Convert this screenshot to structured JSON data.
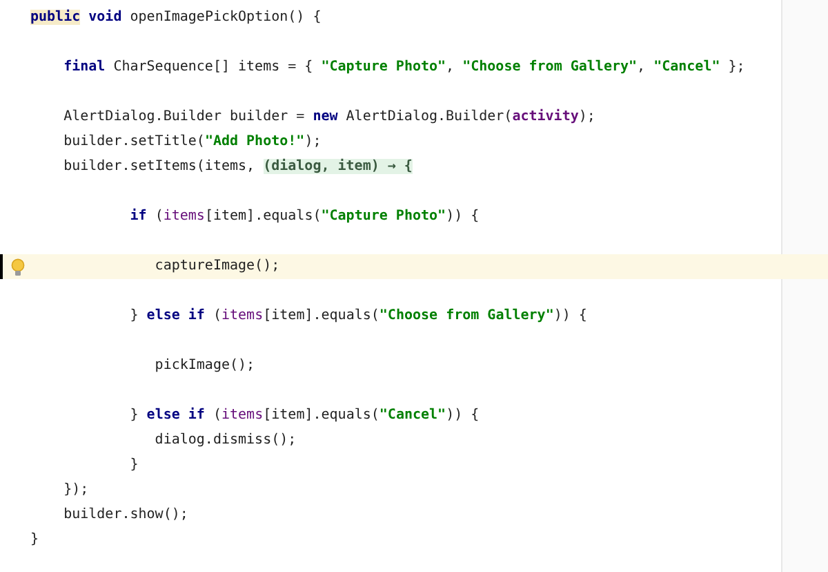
{
  "editor": {
    "lines": [
      {
        "kind": "code",
        "current": false,
        "bulb": false,
        "tokens": [
          {
            "text": "public",
            "kind": "usage"
          },
          {
            "text": " void",
            "kind": "keyword"
          },
          {
            "text": " openImagePickOption() {",
            "kind": "plain"
          }
        ]
      },
      {
        "kind": "blank",
        "current": false,
        "bulb": false
      },
      {
        "kind": "code",
        "current": false,
        "bulb": false,
        "tokens": [
          {
            "text": "    final",
            "kind": "keyword"
          },
          {
            "text": " CharSequence[] items = { ",
            "kind": "plain"
          },
          {
            "text": "\"Capture Photo\"",
            "kind": "string"
          },
          {
            "text": ", ",
            "kind": "plain"
          },
          {
            "text": "\"Choose from Gallery\"",
            "kind": "string"
          },
          {
            "text": ", ",
            "kind": "plain"
          },
          {
            "text": "\"Cancel\"",
            "kind": "string"
          },
          {
            "text": " };",
            "kind": "plain"
          }
        ]
      },
      {
        "kind": "blank",
        "current": false,
        "bulb": false
      },
      {
        "kind": "code",
        "current": false,
        "bulb": false,
        "tokens": [
          {
            "text": "    AlertDialog.Builder builder = ",
            "kind": "plain"
          },
          {
            "text": "new",
            "kind": "keyword"
          },
          {
            "text": " AlertDialog.Builder(",
            "kind": "plain"
          },
          {
            "text": "activity",
            "kind": "field"
          },
          {
            "text": ");",
            "kind": "plain"
          }
        ]
      },
      {
        "kind": "code",
        "current": false,
        "bulb": false,
        "tokens": [
          {
            "text": "    builder.setTitle(",
            "kind": "plain"
          },
          {
            "text": "\"Add Photo!\"",
            "kind": "string"
          },
          {
            "text": ");",
            "kind": "plain"
          }
        ]
      },
      {
        "kind": "code",
        "current": false,
        "bulb": false,
        "tokens": [
          {
            "text": "    builder.setItems(items, ",
            "kind": "plain"
          },
          {
            "text": "(dialog, item) → {",
            "kind": "folded"
          }
        ]
      },
      {
        "kind": "blank",
        "current": false,
        "bulb": false
      },
      {
        "kind": "code",
        "current": false,
        "bulb": false,
        "tokens": [
          {
            "text": "            if",
            "kind": "keyword"
          },
          {
            "text": " (",
            "kind": "plain"
          },
          {
            "text": "items",
            "kind": "captured"
          },
          {
            "text": "[item].equals(",
            "kind": "plain"
          },
          {
            "text": "\"Capture Photo\"",
            "kind": "string"
          },
          {
            "text": ")) {",
            "kind": "plain"
          }
        ]
      },
      {
        "kind": "blank",
        "current": false,
        "bulb": false
      },
      {
        "kind": "code",
        "current": true,
        "bulb": true,
        "tokens": [
          {
            "text": "               captureImage();",
            "kind": "plain"
          }
        ]
      },
      {
        "kind": "blank",
        "current": false,
        "bulb": false
      },
      {
        "kind": "code",
        "current": false,
        "bulb": false,
        "tokens": [
          {
            "text": "            } ",
            "kind": "plain"
          },
          {
            "text": "else if",
            "kind": "keyword"
          },
          {
            "text": " (",
            "kind": "plain"
          },
          {
            "text": "items",
            "kind": "captured"
          },
          {
            "text": "[item].equals(",
            "kind": "plain"
          },
          {
            "text": "\"Choose from Gallery\"",
            "kind": "string"
          },
          {
            "text": ")) {",
            "kind": "plain"
          }
        ]
      },
      {
        "kind": "blank",
        "current": false,
        "bulb": false
      },
      {
        "kind": "code",
        "current": false,
        "bulb": false,
        "tokens": [
          {
            "text": "               pickImage();",
            "kind": "plain"
          }
        ]
      },
      {
        "kind": "blank",
        "current": false,
        "bulb": false
      },
      {
        "kind": "code",
        "current": false,
        "bulb": false,
        "tokens": [
          {
            "text": "            } ",
            "kind": "plain"
          },
          {
            "text": "else if",
            "kind": "keyword"
          },
          {
            "text": " (",
            "kind": "plain"
          },
          {
            "text": "items",
            "kind": "captured"
          },
          {
            "text": "[item].equals(",
            "kind": "plain"
          },
          {
            "text": "\"Cancel\"",
            "kind": "string"
          },
          {
            "text": ")) {",
            "kind": "plain"
          }
        ]
      },
      {
        "kind": "code",
        "current": false,
        "bulb": false,
        "tokens": [
          {
            "text": "               dialog.dismiss();",
            "kind": "plain"
          }
        ]
      },
      {
        "kind": "code",
        "current": false,
        "bulb": false,
        "tokens": [
          {
            "text": "            }",
            "kind": "plain"
          }
        ]
      },
      {
        "kind": "code",
        "current": false,
        "bulb": false,
        "tokens": [
          {
            "text": "    });",
            "kind": "plain"
          }
        ]
      },
      {
        "kind": "code",
        "current": false,
        "bulb": false,
        "tokens": [
          {
            "text": "    builder.show();",
            "kind": "plain"
          }
        ]
      },
      {
        "kind": "code",
        "current": false,
        "bulb": false,
        "tokens": [
          {
            "text": "}",
            "kind": "plain"
          }
        ]
      }
    ]
  }
}
